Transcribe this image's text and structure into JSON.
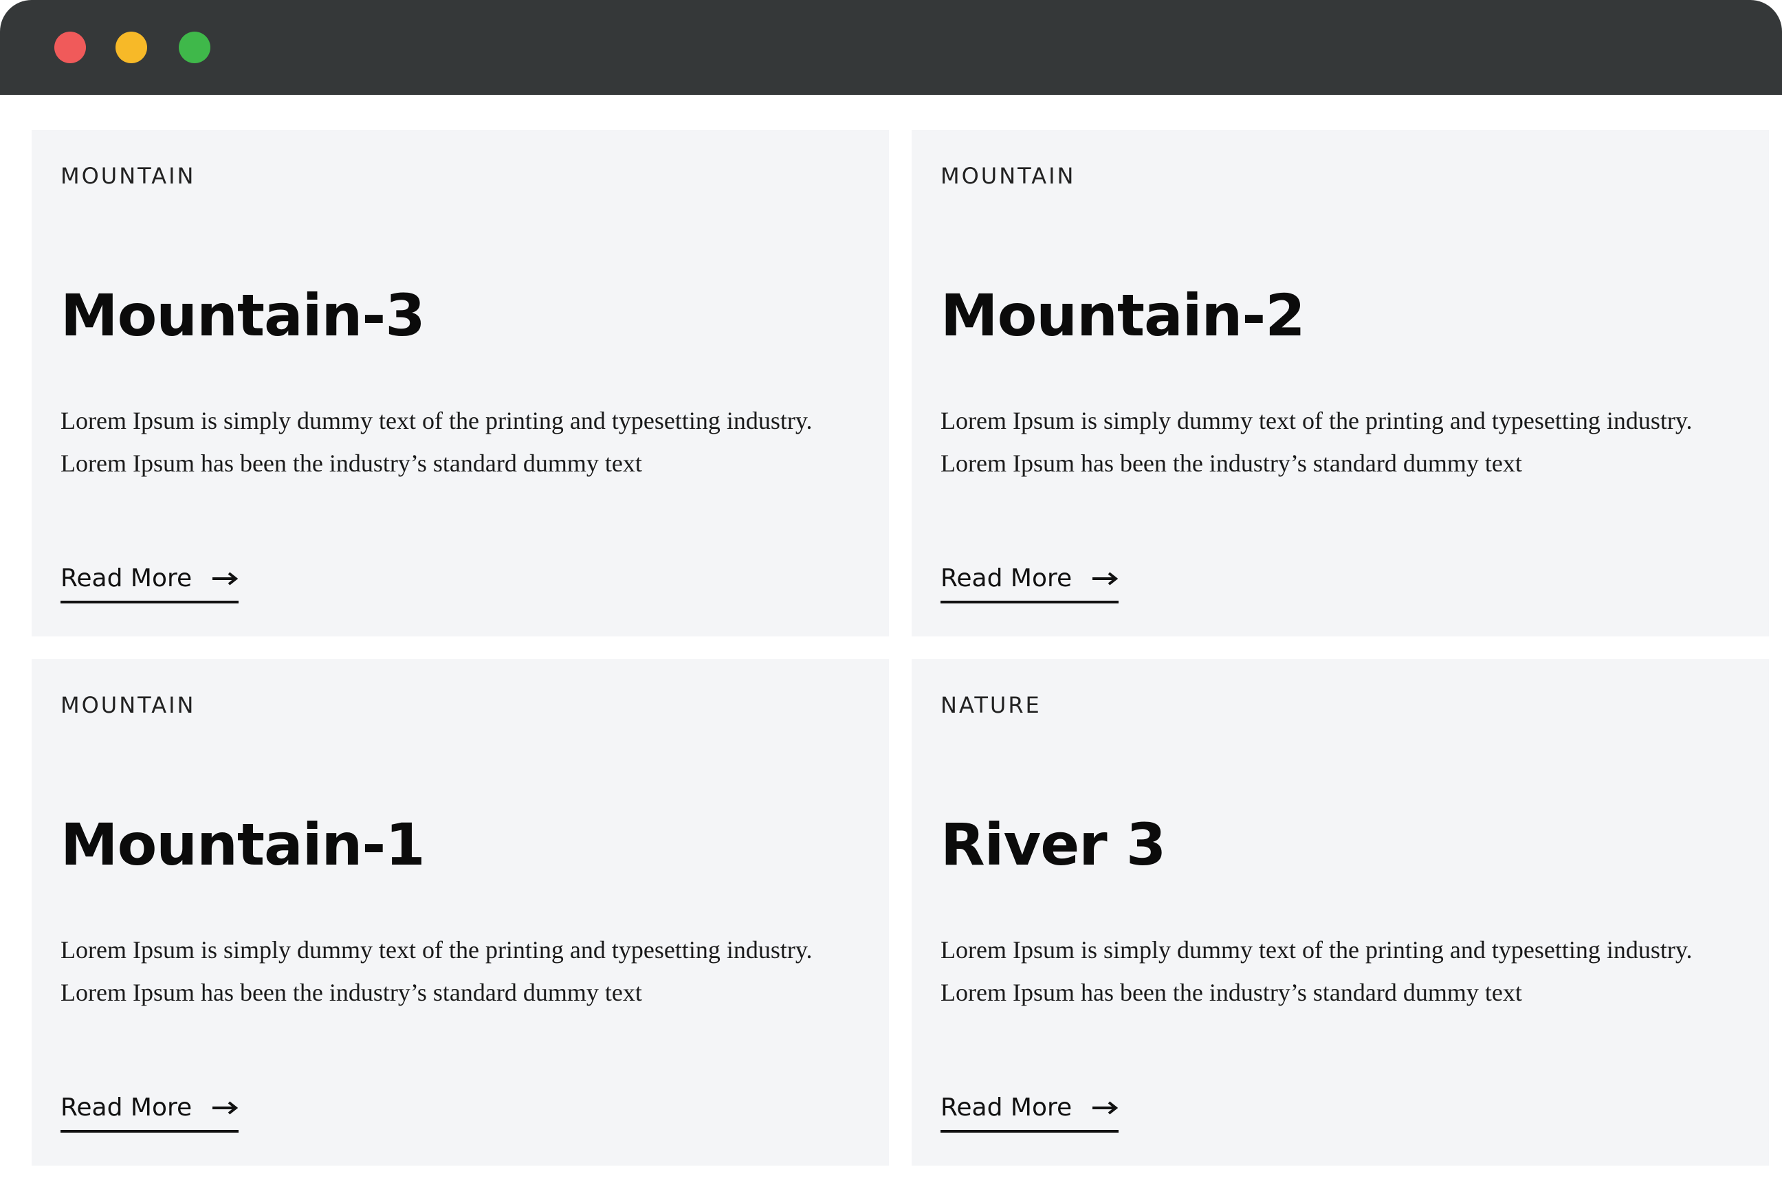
{
  "window": {
    "controls": [
      {
        "name": "close",
        "color": "#f05a5a"
      },
      {
        "name": "minimize",
        "color": "#f7b928"
      },
      {
        "name": "maximize",
        "color": "#3fb84a"
      }
    ]
  },
  "cards": [
    {
      "category": "MOUNTAIN",
      "title": "Mountain-3",
      "description": "Lorem Ipsum is simply dummy text of the printing and typesetting industry. Lorem Ipsum has been the industry’s standard dummy text",
      "link_label": "Read More",
      "link_icon": "arrow-right-icon"
    },
    {
      "category": "MOUNTAIN",
      "title": "Mountain-2",
      "description": "Lorem Ipsum is simply dummy text of the printing and typesetting industry. Lorem Ipsum has been the industry’s standard dummy text",
      "link_label": "Read More",
      "link_icon": "arrow-right-icon"
    },
    {
      "category": "MOUNTAIN",
      "title": "Mountain-1",
      "description": "Lorem Ipsum is simply dummy text of the printing and typesetting industry. Lorem Ipsum has been the industry’s standard dummy text",
      "link_label": "Read More",
      "link_icon": "arrow-right-icon"
    },
    {
      "category": "NATURE",
      "title": "River 3",
      "description": "Lorem Ipsum is simply dummy text of the printing and typesetting industry. Lorem Ipsum has been the industry’s standard dummy text",
      "link_label": "Read More",
      "link_icon": "arrow-right-icon"
    }
  ]
}
